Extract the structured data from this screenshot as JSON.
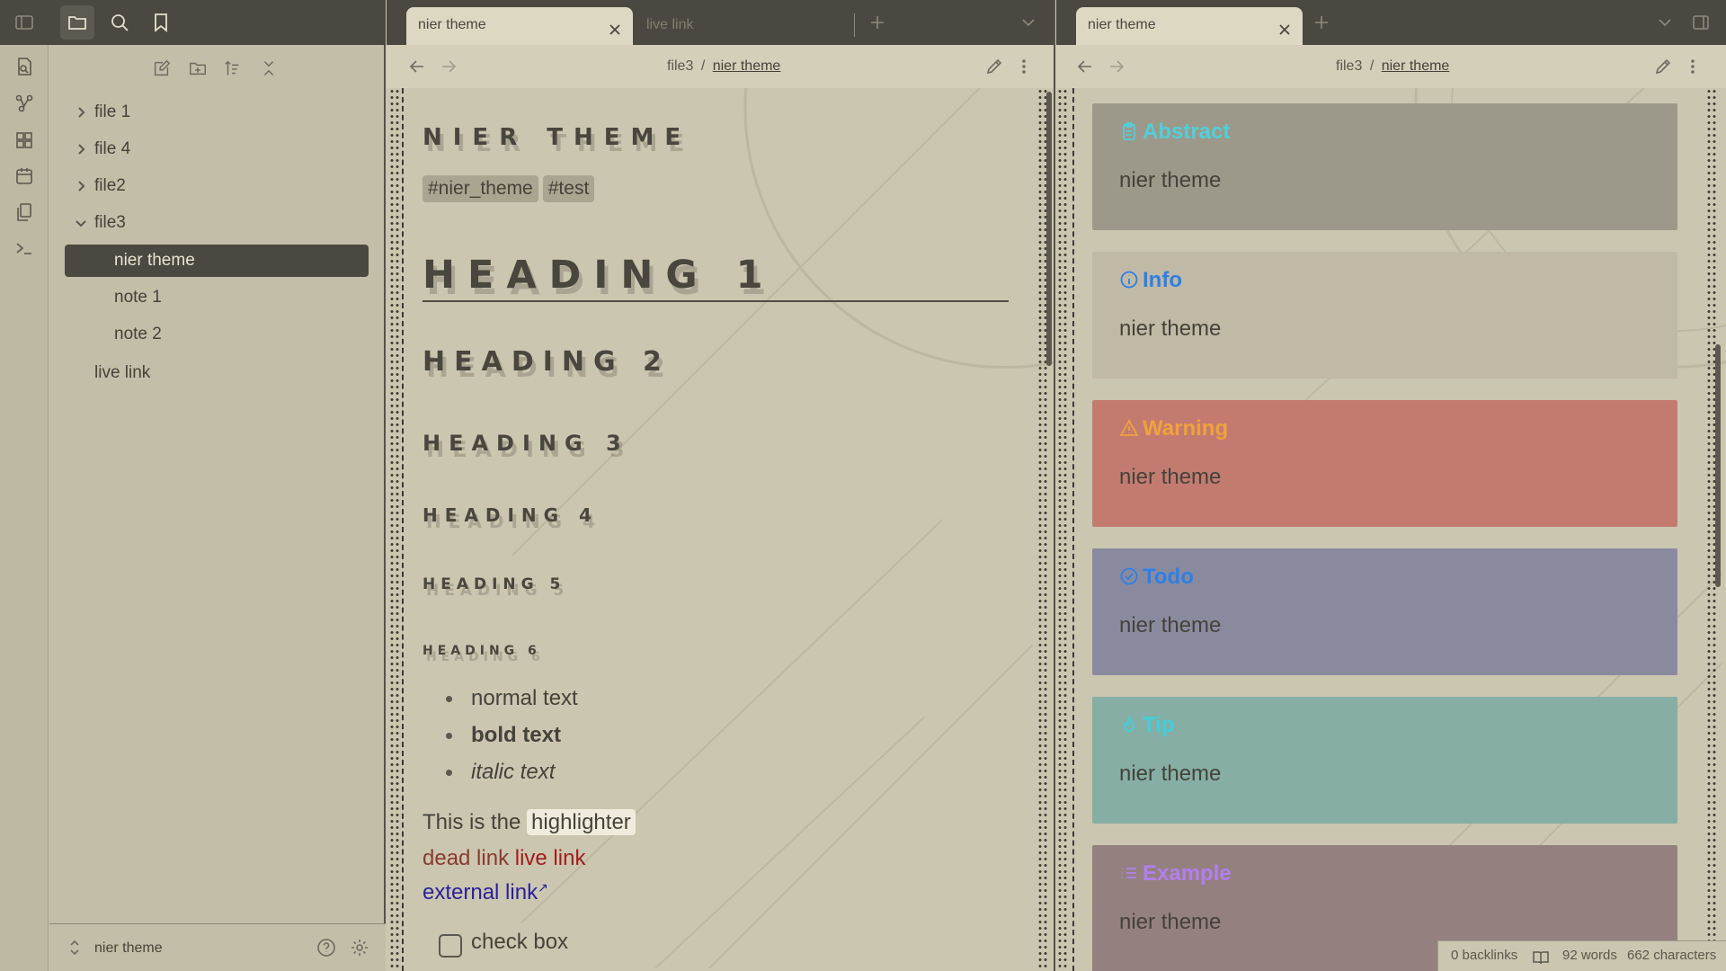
{
  "sidebar": {
    "new_note_label": "",
    "tree": [
      {
        "label": "file 1",
        "expanded": false
      },
      {
        "label": "file 4",
        "expanded": false
      },
      {
        "label": "file2",
        "expanded": false
      },
      {
        "label": "file3",
        "expanded": true
      },
      {
        "label": "nier theme",
        "active": true
      },
      {
        "label": "note 1"
      },
      {
        "label": "note 2"
      },
      {
        "label": "live link"
      }
    ],
    "vault_name": "nier theme"
  },
  "left_pane": {
    "tabs": [
      {
        "label": "nier theme",
        "active": true
      },
      {
        "label": "live link",
        "active": false
      }
    ],
    "breadcrumb": {
      "folder": "file3",
      "separator": "/",
      "current": "nier theme"
    },
    "note": {
      "title": "NIER THEME",
      "tags": [
        "#nier_theme",
        "#test"
      ],
      "headings": [
        "HEADING 1",
        "HEADING 2",
        "HEADING 3",
        "HEADING 4",
        "HEADING 5",
        "HEADING 6"
      ],
      "list": [
        "normal text",
        "bold text",
        "italic text"
      ],
      "highlight_prefix": "This is the",
      "highlight_text": "highlighter",
      "dead_link": "dead link",
      "live_link": "live link",
      "external_link": "external link",
      "checkbox_label": "check box"
    }
  },
  "right_pane": {
    "tabs": [
      {
        "label": "nier theme",
        "active": true
      }
    ],
    "breadcrumb": {
      "folder": "file3",
      "separator": "/",
      "current": "nier theme"
    },
    "callouts": [
      {
        "title": "Abstract",
        "body": "nier theme",
        "icon": "clipboard-icon",
        "bg": "#9d998a",
        "color": "#4fd0dc"
      },
      {
        "title": "Info",
        "body": "nier theme",
        "icon": "info-icon",
        "bg": "#c0b9a5",
        "color": "#2d7fe6"
      },
      {
        "title": "Warning",
        "body": "nier theme",
        "icon": "alert-triangle-icon",
        "bg": "#c37b70",
        "color": "#f0a23c"
      },
      {
        "title": "Todo",
        "body": "nier theme",
        "icon": "check-circle-icon",
        "bg": "#8a8a9f",
        "color": "#2d7fe6"
      },
      {
        "title": "Tip",
        "body": "nier theme",
        "icon": "flame-icon",
        "bg": "#86aea5",
        "color": "#3fd0dc"
      },
      {
        "title": "Example",
        "body": "nier theme",
        "icon": "list-icon",
        "bg": "#958080",
        "color": "#b27ff0"
      }
    ]
  },
  "statusbar": {
    "backlinks": "0 backlinks",
    "words": "92 words",
    "characters": "662 characters"
  }
}
